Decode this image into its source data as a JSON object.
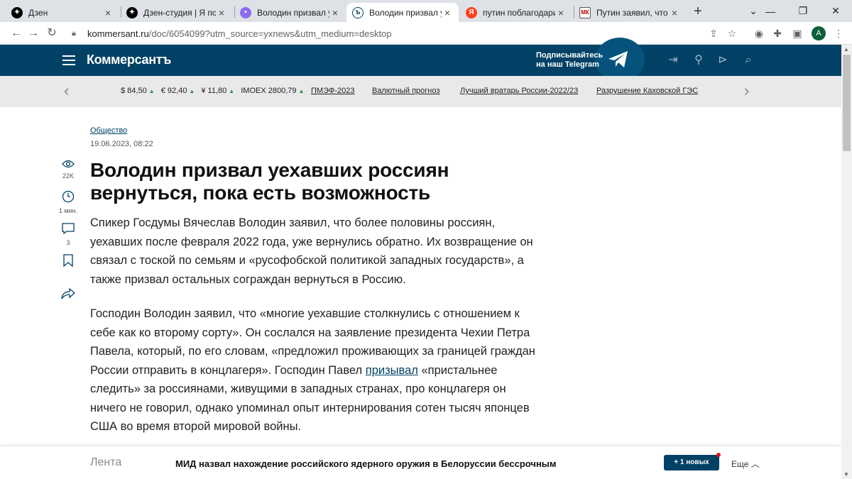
{
  "browser": {
    "tabs": [
      {
        "title": "Дзен",
        "icon": "dzen-icon"
      },
      {
        "title": "Дзен-студия | Я подо",
        "icon": "dzen-icon"
      },
      {
        "title": "Володин призвал уе",
        "icon": "chat-icon"
      },
      {
        "title": "Володин призвал уе",
        "icon": "kommersant-icon",
        "active": true
      },
      {
        "title": "путин поблагодарил",
        "icon": "yandex-icon"
      },
      {
        "title": "Путин заявил, что Сh",
        "icon": "mk-icon"
      }
    ],
    "new_tab": "+",
    "url_host": "kommersant.ru",
    "url_rest": "/doc/6054099?utm_source=yxnews&utm_medium=desktop",
    "profile_initial": "A",
    "window_controls": [
      "minimize",
      "restore",
      "close"
    ]
  },
  "header": {
    "logo": "Коммерсантъ",
    "telegram_line1": "Подписывайтесь",
    "telegram_line2": "на наш Telegram",
    "icons": [
      "login-icon",
      "location-icon",
      "radio-icon",
      "search-icon"
    ]
  },
  "strip": {
    "rates": [
      {
        "label": "$ 84,50",
        "trend": "▲"
      },
      {
        "label": "€ 92,40",
        "trend": "▲"
      },
      {
        "label": "¥ 11,80",
        "trend": "▲"
      },
      {
        "label": "IMOEX 2800,79",
        "trend": "▲"
      }
    ],
    "links": [
      "ПМЭФ-2023",
      "Валютный прогноз",
      "Лучший вратарь России-2022/23",
      "Разрушение Каховской ГЭС"
    ]
  },
  "article": {
    "rubric": "Общество",
    "date": "19.06.2023, 08:22",
    "title": "Володин призвал уехавших россиян вернуться, пока есть возможность",
    "p1": "Спикер Госдумы Вячеслав Володин заявил, что более половины россиян, уехавших после февраля 2022 года, уже вернулись обратно. Их возвращение он связал с тоской по семьям и «русофобской политикой западных государств», а также призвал остальных сограждан вернуться в Россию.",
    "p2_before": "Господин Володин заявил, что «многие уехавшие столкнулись с отношением к себе как ко второму сорту». Он сослался на заявление президента Чехии Петра Павела, который, по его словам, «предложил проживающих за границей граждан России отправить в концлагеря». Господин Павел ",
    "p2_link": "призывал",
    "p2_after": " «пристальнее следить» за россиянами, живущими в западных странах, про концлагеря он ничего не говорил, однако упоминал опыт интернирования сотен тысяч японцев США во время второй мировой войны."
  },
  "sidebar": {
    "views": "22K",
    "read_time": "1 мин.",
    "comments": "3"
  },
  "bottom": {
    "lenta": "Лента",
    "headline": "МИД назвал нахождение российского ядерного оружия в Белоруссии бессрочным",
    "new_button": "+ 1 новых",
    "more": "Еще"
  }
}
